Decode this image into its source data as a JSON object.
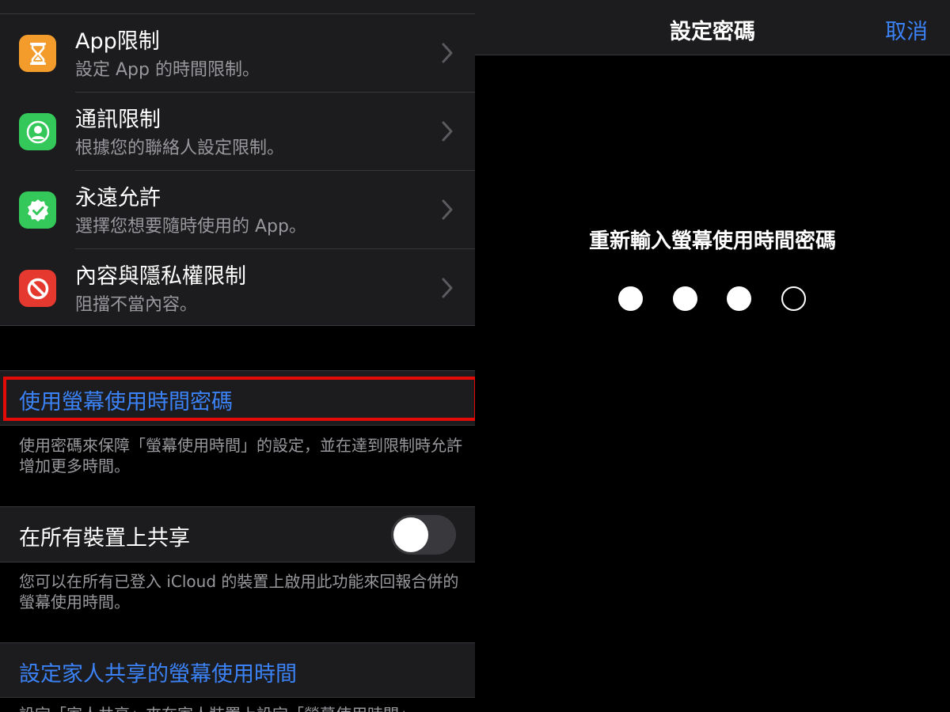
{
  "left": {
    "items": [
      {
        "title": "App限制",
        "subtitle": "設定 App 的時間限制。",
        "icon": "hourglass-icon",
        "color": "#f39c2b"
      },
      {
        "title": "通訊限制",
        "subtitle": "根據您的聯絡人設定限制。",
        "icon": "person-circle-icon",
        "color": "#34c759"
      },
      {
        "title": "永遠允許",
        "subtitle": "選擇您想要隨時使用的 App。",
        "icon": "checkmark-seal-icon",
        "color": "#34c759"
      },
      {
        "title": "內容與隱私權限制",
        "subtitle": "阻擋不當內容。",
        "icon": "prohibited-icon",
        "color": "#e5382f"
      }
    ],
    "passcode_link": "使用螢幕使用時間密碼",
    "passcode_note": "使用密碼來保障「螢幕使用時間」的設定，並在達到限制時允許增加更多時間。",
    "share_label": "在所有裝置上共享",
    "share_toggle_on": false,
    "share_note": "您可以在所有已登入 iCloud 的裝置上啟用此功能來回報合併的螢幕使用時間。",
    "family_link": "設定家人共享的螢幕使用時間",
    "family_note": "設定「家人共享」來在家人裝置上設定「螢幕使用時間」。"
  },
  "right": {
    "nav_title": "設定密碼",
    "cancel_label": "取消",
    "prompt": "重新輸入螢幕使用時間密碼",
    "passcode_length": 4,
    "entered_digits": 3
  },
  "colors": {
    "accent": "#3b82f6",
    "highlight": "#e50a0a"
  }
}
